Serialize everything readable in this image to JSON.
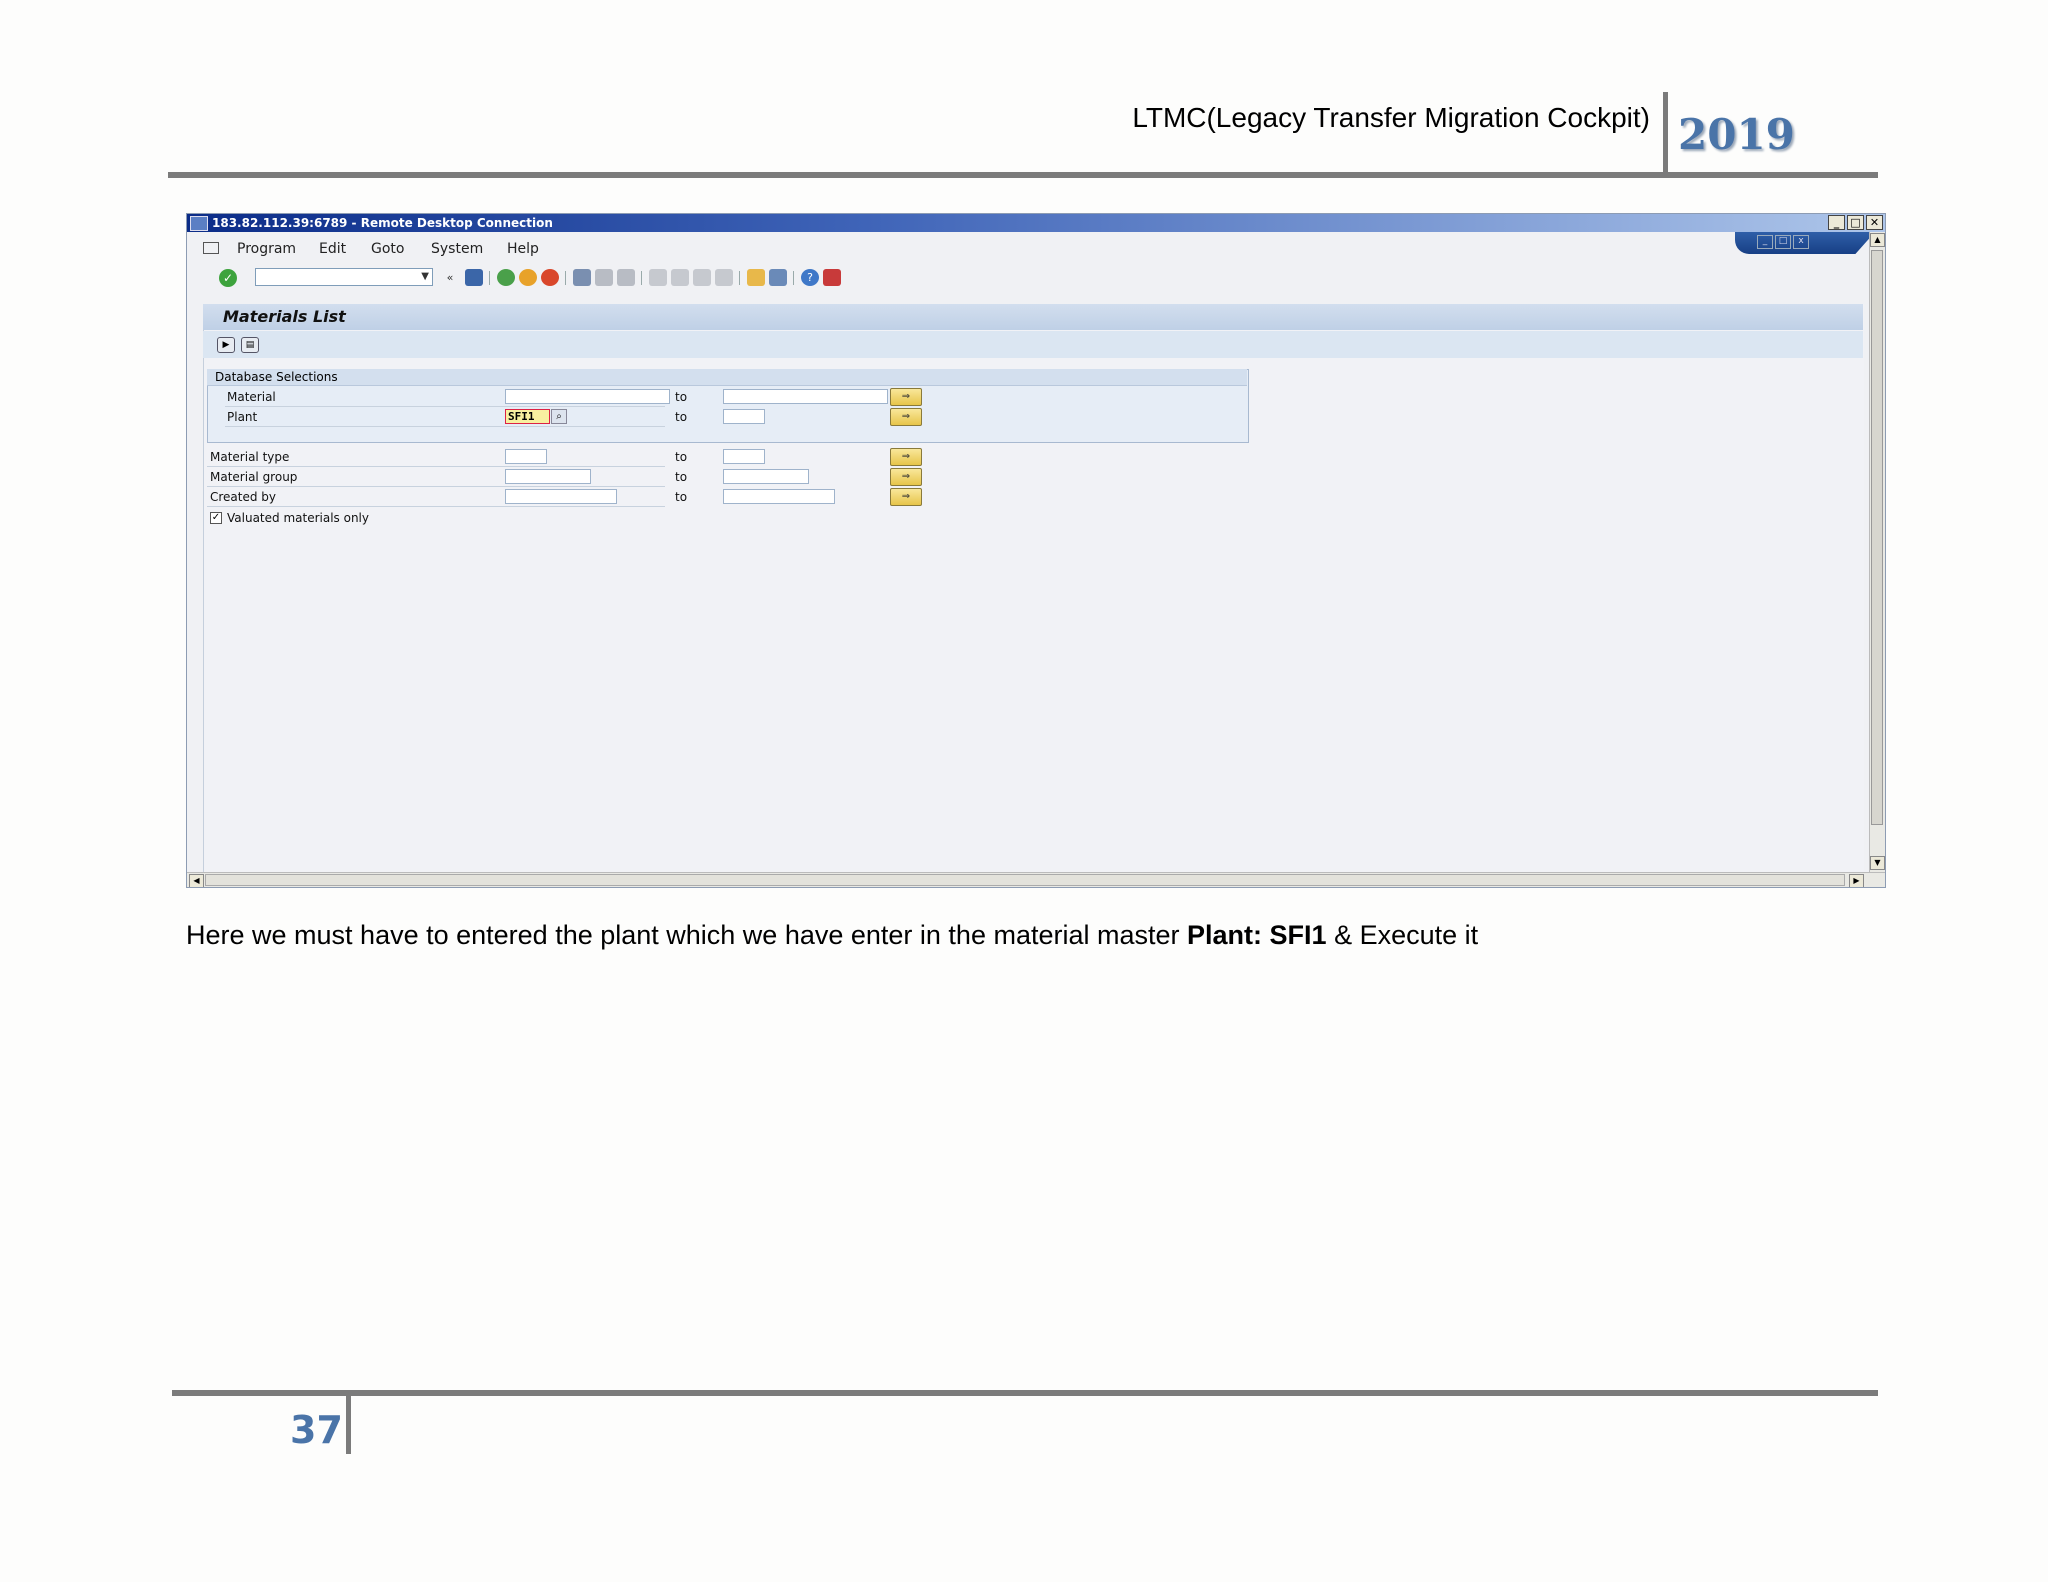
{
  "document": {
    "header_title": "LTMC(Legacy Transfer Migration Cockpit)",
    "year": "2019",
    "page_number": "37",
    "caption_before": "Here we must have to  entered the plant which we have enter in the material master ",
    "caption_bold": "Plant: SFI1",
    "caption_after": " & Execute it"
  },
  "window": {
    "title": "183.82.112.39:6789 - Remote Desktop Connection",
    "controls": [
      "_",
      "□",
      "✕"
    ]
  },
  "menu": [
    "Program",
    "Edit",
    "Goto",
    "System",
    "Help"
  ],
  "screen": {
    "title": "Materials List",
    "group_title": "Database Selections",
    "to_label": "to",
    "rows": [
      {
        "label": "Material",
        "from": "",
        "to": ""
      },
      {
        "label": "Plant",
        "from": "SFI1",
        "to": ""
      },
      {
        "label": "Material type",
        "from": "",
        "to": ""
      },
      {
        "label": "Material group",
        "from": "",
        "to": ""
      },
      {
        "label": "Created by",
        "from": "",
        "to": ""
      }
    ],
    "checkbox_label": "Valuated materials only",
    "checkbox_checked": true
  },
  "icons": [
    "enter-icon",
    "back-icon",
    "save-icon",
    "exit-icon",
    "cancel-icon",
    "print-icon",
    "find-icon",
    "help-icon"
  ],
  "colors": {
    "title_bar": "#0b2c88",
    "accent": "#4a74a8",
    "highlight": "#f8f0a0"
  }
}
